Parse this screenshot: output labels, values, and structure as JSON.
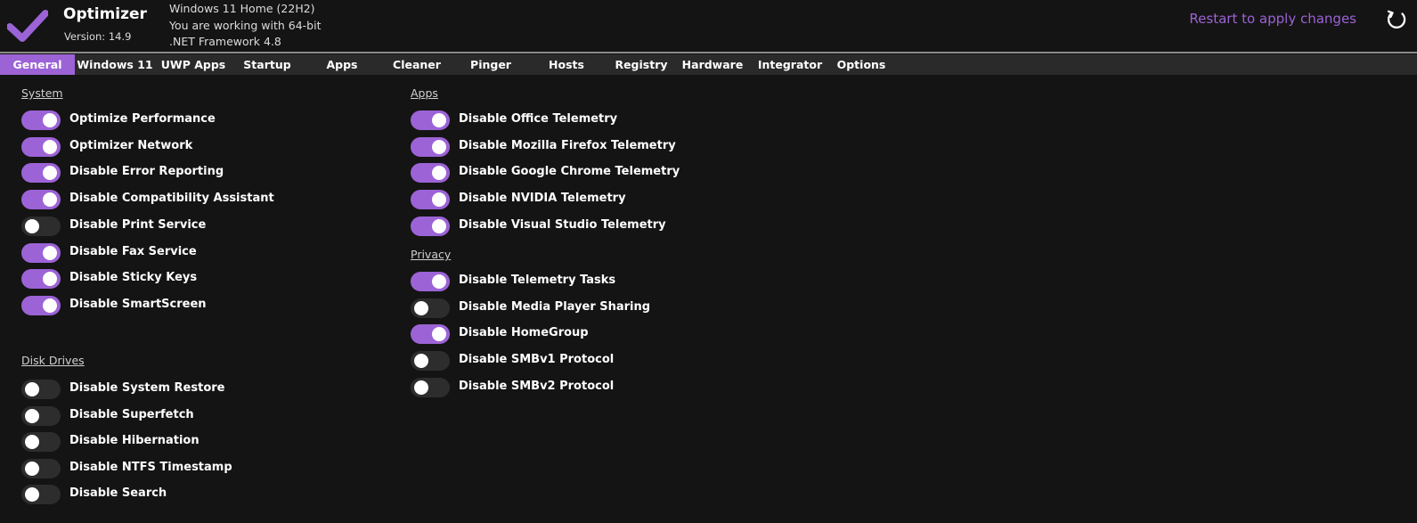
{
  "app": {
    "title": "Optimizer",
    "version": "Version: 14.9",
    "accent_color": "#9c63d6",
    "logo_icon": "checkmark-icon"
  },
  "sysinfo": {
    "line1": "Windows 11 Home (22H2)",
    "line2": "You are working with 64-bit",
    "line3": ".NET Framework 4.8"
  },
  "header": {
    "restart_label": "Restart to apply changes",
    "restart_icon": "refresh-icon"
  },
  "tabs": [
    {
      "label": "General",
      "active": true
    },
    {
      "label": "Windows 11",
      "active": false
    },
    {
      "label": "UWP Apps",
      "active": false
    },
    {
      "label": "Startup",
      "active": false
    },
    {
      "label": "Apps",
      "active": false
    },
    {
      "label": "Cleaner",
      "active": false
    },
    {
      "label": "Pinger",
      "active": false
    },
    {
      "label": "Hosts",
      "active": false
    },
    {
      "label": "Registry",
      "active": false
    },
    {
      "label": "Hardware",
      "active": false
    },
    {
      "label": "Integrator",
      "active": false
    },
    {
      "label": "Options",
      "active": false
    }
  ],
  "sections": {
    "system": {
      "title": "System",
      "items": [
        {
          "label": "Optimize Performance",
          "on": true
        },
        {
          "label": "Optimizer Network",
          "on": true
        },
        {
          "label": "Disable Error Reporting",
          "on": true
        },
        {
          "label": "Disable Compatibility Assistant",
          "on": true
        },
        {
          "label": "Disable Print Service",
          "on": false
        },
        {
          "label": "Disable Fax Service",
          "on": true
        },
        {
          "label": "Disable Sticky Keys",
          "on": true
        },
        {
          "label": "Disable SmartScreen",
          "on": true
        }
      ]
    },
    "disk": {
      "title": "Disk Drives",
      "items": [
        {
          "label": "Disable System Restore",
          "on": false
        },
        {
          "label": "Disable Superfetch",
          "on": false
        },
        {
          "label": "Disable Hibernation",
          "on": false
        },
        {
          "label": "Disable NTFS Timestamp",
          "on": false
        },
        {
          "label": "Disable Search",
          "on": false
        }
      ]
    },
    "apps": {
      "title": "Apps",
      "items": [
        {
          "label": "Disable Office Telemetry",
          "on": true
        },
        {
          "label": "Disable Mozilla Firefox Telemetry",
          "on": true
        },
        {
          "label": "Disable Google Chrome Telemetry",
          "on": true
        },
        {
          "label": "Disable NVIDIA Telemetry",
          "on": true
        },
        {
          "label": "Disable Visual Studio Telemetry",
          "on": true
        }
      ]
    },
    "privacy": {
      "title": "Privacy",
      "items": [
        {
          "label": "Disable Telemetry Tasks",
          "on": true
        },
        {
          "label": "Disable Media Player Sharing",
          "on": false
        },
        {
          "label": "Disable HomeGroup",
          "on": true
        },
        {
          "label": "Disable SMBv1 Protocol",
          "on": false
        },
        {
          "label": "Disable SMBv2 Protocol",
          "on": false
        }
      ]
    }
  }
}
